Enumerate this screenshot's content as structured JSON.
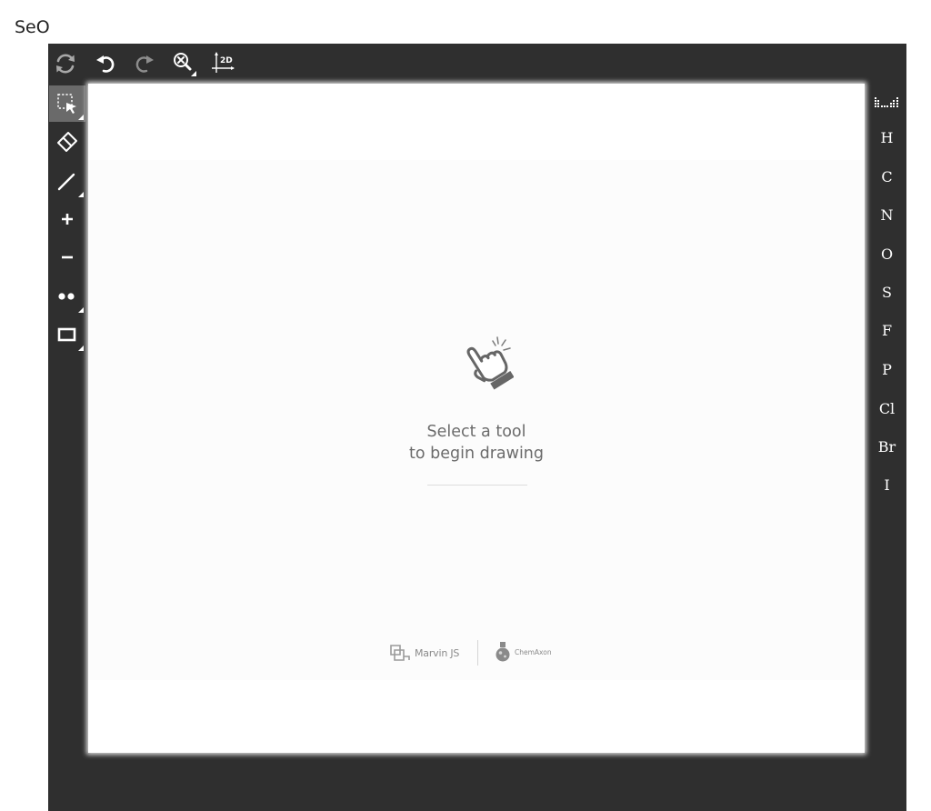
{
  "question_label": "SeO",
  "top_toolbar": [
    {
      "name": "clean-icon"
    },
    {
      "name": "undo-icon"
    },
    {
      "name": "redo-icon"
    },
    {
      "name": "zoom-icon"
    },
    {
      "name": "clean-2d-icon",
      "label": "2D"
    }
  ],
  "left_toolbar": [
    {
      "name": "select-tool-icon",
      "active": true
    },
    {
      "name": "eraser-icon"
    },
    {
      "name": "single-bond-icon"
    },
    {
      "name": "increase-charge-icon"
    },
    {
      "name": "decrease-charge-icon"
    },
    {
      "name": "radical-icon"
    },
    {
      "name": "rectangle-icon"
    }
  ],
  "canvas": {
    "splash_line1": "Select a tool",
    "splash_line2": "to begin drawing",
    "brand1": "Marvin JS",
    "brand2": "ChemAxon"
  },
  "elements": [
    "H",
    "C",
    "N",
    "O",
    "S",
    "F",
    "P",
    "Cl",
    "Br",
    "I"
  ],
  "colors": {
    "toolbar_bg": "#2f2f2f",
    "active_tool_bg": "#6a6a6a",
    "canvas_bg": "#ffffff",
    "splash_text": "#6b6b6b"
  }
}
